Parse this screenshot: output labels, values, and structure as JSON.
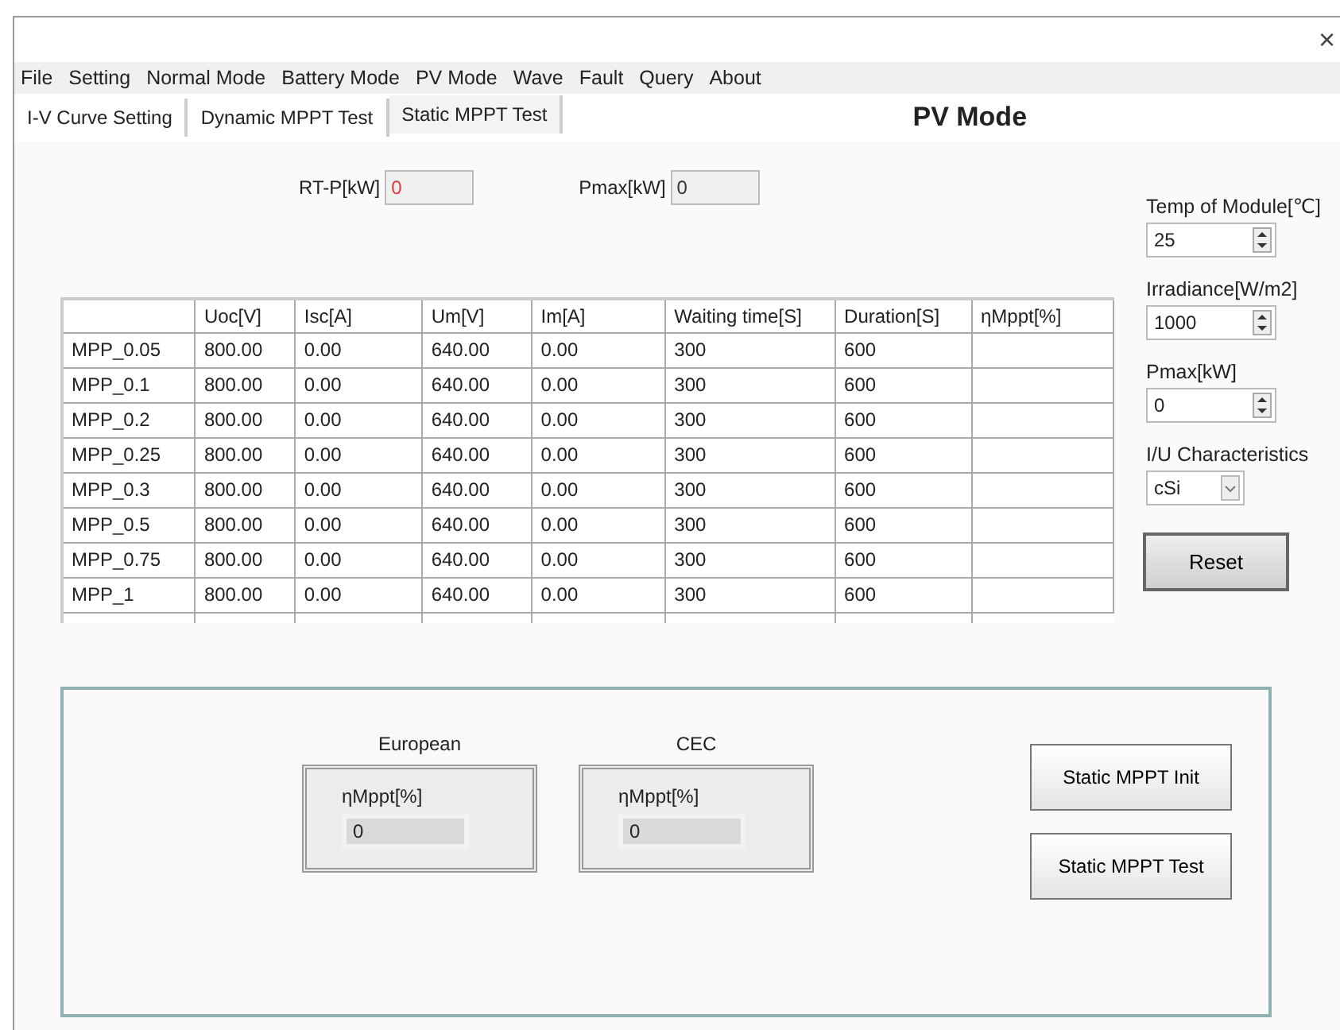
{
  "window": {
    "close": "×"
  },
  "menu": [
    "File",
    "Setting",
    "Normal Mode",
    "Battery Mode",
    "PV Mode",
    "Wave",
    "Fault",
    "Query",
    "About"
  ],
  "tabs": [
    {
      "label": "I-V Curve Setting",
      "selected": false
    },
    {
      "label": "Dynamic MPPT Test",
      "selected": false
    },
    {
      "label": "Static MPPT Test",
      "selected": true
    }
  ],
  "mode_title": "PV Mode",
  "readouts": [
    {
      "label": "RT-P[kW]",
      "value": "0",
      "color": "#e03a3a"
    },
    {
      "label": "Pmax[kW]",
      "value": "0",
      "color": "#333333"
    }
  ],
  "table": {
    "columns": [
      "Uoc[V]",
      "Isc[A]",
      "Um[V]",
      "Im[A]",
      "Waiting time[S]",
      "Duration[S]",
      "ηMppt[%]"
    ],
    "rows": [
      {
        "label": "MPP_0.05",
        "cells": [
          "800.00",
          "0.00",
          "640.00",
          "0.00",
          "300",
          "600"
        ]
      },
      {
        "label": "MPP_0.1",
        "cells": [
          "800.00",
          "0.00",
          "640.00",
          "0.00",
          "300",
          "600"
        ]
      },
      {
        "label": "MPP_0.2",
        "cells": [
          "800.00",
          "0.00",
          "640.00",
          "0.00",
          "300",
          "600"
        ]
      },
      {
        "label": "MPP_0.25",
        "cells": [
          "800.00",
          "0.00",
          "640.00",
          "0.00",
          "300",
          "600"
        ]
      },
      {
        "label": "MPP_0.3",
        "cells": [
          "800.00",
          "0.00",
          "640.00",
          "0.00",
          "300",
          "600"
        ]
      },
      {
        "label": "MPP_0.5",
        "cells": [
          "800.00",
          "0.00",
          "640.00",
          "0.00",
          "300",
          "600"
        ]
      },
      {
        "label": "MPP_0.75",
        "cells": [
          "800.00",
          "0.00",
          "640.00",
          "0.00",
          "300",
          "600"
        ]
      },
      {
        "label": "MPP_1",
        "cells": [
          "800.00",
          "0.00",
          "640.00",
          "0.00",
          "300",
          "600"
        ]
      }
    ]
  },
  "settings": [
    {
      "kind": "spinner",
      "label": "Temp of Module[℃]",
      "value": "25"
    },
    {
      "kind": "spinner",
      "label": "Irradiance[W/m2]",
      "value": "1000"
    },
    {
      "kind": "spinner",
      "label": "Pmax[kW]",
      "value": "0"
    },
    {
      "kind": "select",
      "label": "I/U Characteristics",
      "value": "cSi"
    }
  ],
  "reset_button": "Reset",
  "efficiency": [
    {
      "title": "European",
      "label": "ηMppt[%]",
      "value": "0"
    },
    {
      "title": "CEC",
      "label": "ηMppt[%]",
      "value": "0"
    }
  ],
  "actions": [
    "Static MPPT Init",
    "Static MPPT Test"
  ]
}
